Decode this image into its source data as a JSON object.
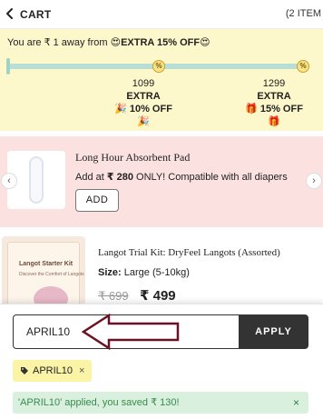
{
  "header": {
    "title": "CART",
    "item_count": "(2 ITEM"
  },
  "offer_progress": {
    "message_prefix": "You are ₹ 1 away from",
    "message_bold": "EXTRA 15% OFF",
    "milestones": [
      {
        "amount": "1099",
        "label": "EXTRA",
        "discount": "10% OFF"
      },
      {
        "amount": "1299",
        "label": "EXTRA",
        "discount": "15% OFF"
      }
    ],
    "milestone_icon_glyph": "%",
    "progress_fraction": 0.999
  },
  "upsell": {
    "title": "Long Hour Absorbent Pad",
    "desc_prefix": "Add at",
    "desc_price": "₹ 280",
    "desc_suffix": "ONLY! Compatible with all diapers",
    "add_label": "ADD"
  },
  "cart_item": {
    "title": "Langot Trial Kit: DryFeel Langots (Assorted)",
    "size_label": "Size:",
    "size_value": "Large (5-10kg)",
    "price_old": "₹ 699",
    "price_new": "₹ 499",
    "image_title": "Langot Starter Kit",
    "image_subtitle": "Discover the Comfort of Langots"
  },
  "coupon": {
    "input_value": "APRIL10",
    "apply_label": "APPLY",
    "applied_chip": "APRIL10",
    "chip_remove": "×",
    "success_message": "'APRIL10' applied, you saved ₹ 130!",
    "success_close": "×"
  },
  "colors": {
    "progress_bg": "#fdf8cc",
    "upsell_bg": "#fbe2e1",
    "apply_bg": "#333333",
    "success_bg": "#d8f0dd",
    "annotation_arrow": "#6e1023"
  }
}
